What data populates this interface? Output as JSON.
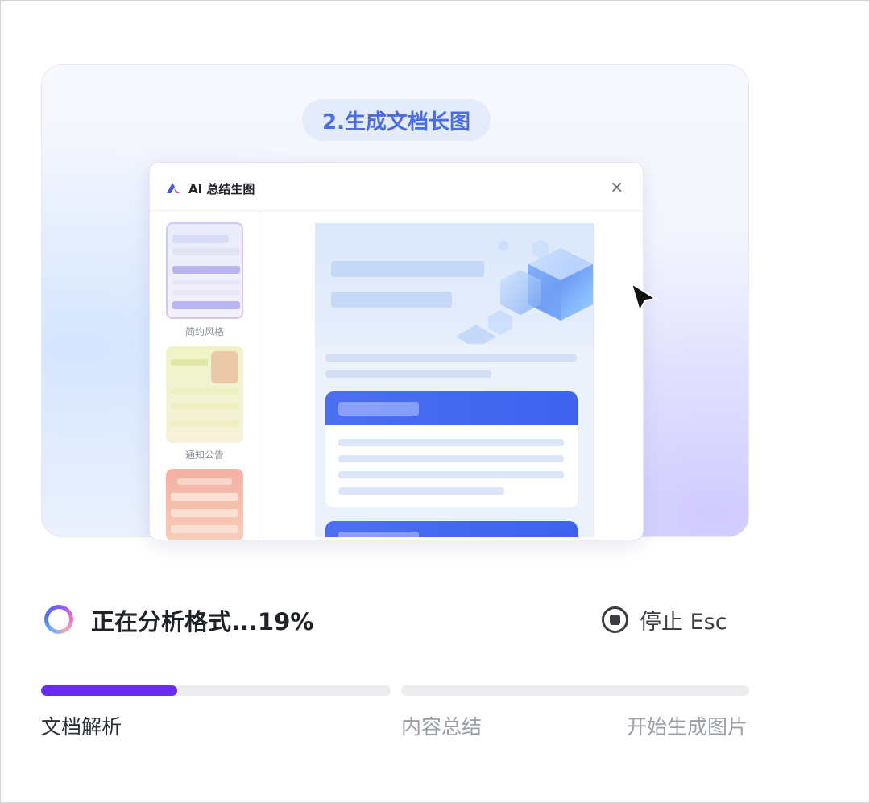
{
  "preview": {
    "step_label": "2.生成文档长图",
    "dialog": {
      "title": "AI 总结生图",
      "close_icon": "close-icon",
      "templates": [
        {
          "label": "简约风格"
        },
        {
          "label": "通知公告"
        },
        {
          "label": ""
        }
      ]
    }
  },
  "status": {
    "text": "正在分析格式...19%",
    "progress_percent": 19,
    "stop_label": "停止 Esc"
  },
  "stages": [
    {
      "label": "文档解析",
      "progress": 0.39
    },
    {
      "label": "内容总结",
      "progress": 0
    },
    {
      "label": "开始生成图片",
      "progress": 0
    }
  ],
  "colors": {
    "accent": "#6a2cf0",
    "pill_text": "#4a6ee0",
    "card_blue": "#4c6ff2"
  }
}
